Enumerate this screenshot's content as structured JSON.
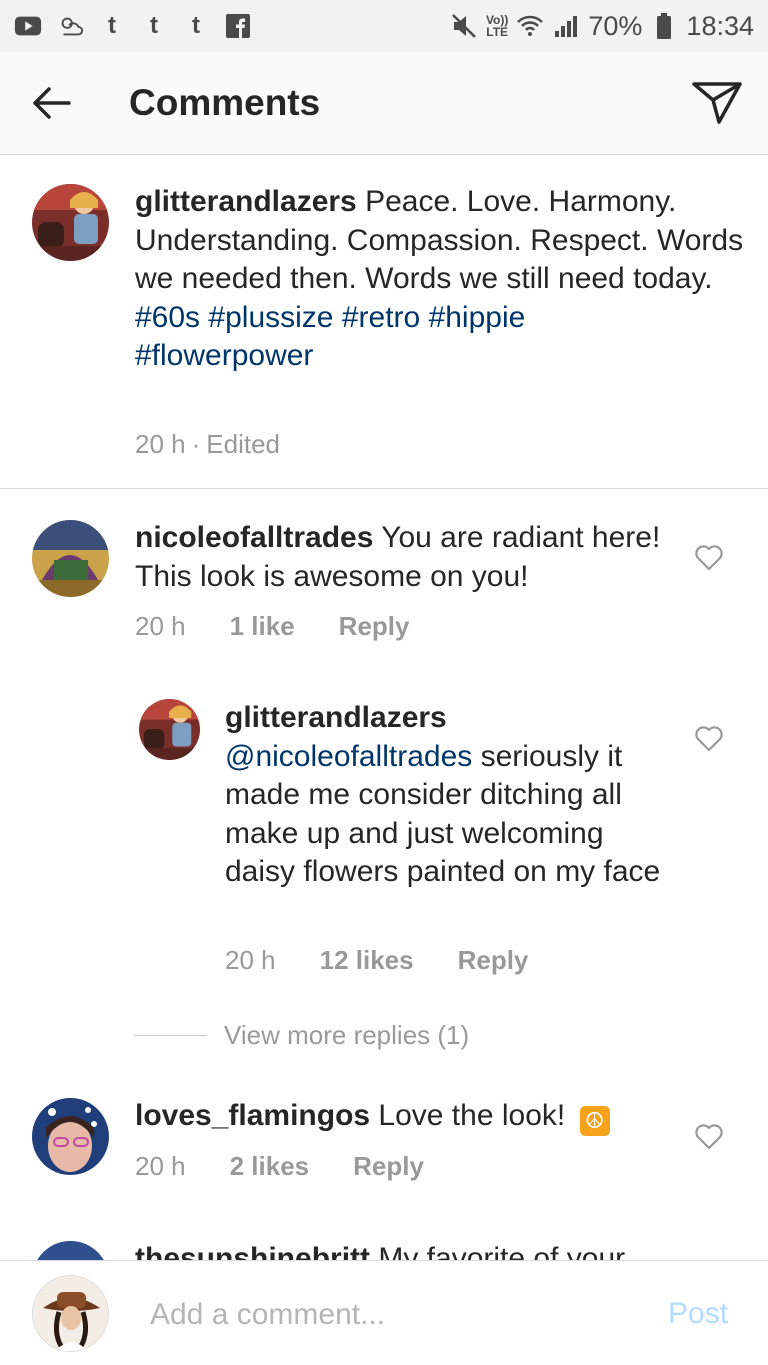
{
  "status_bar": {
    "left_icons": [
      "youtube-icon",
      "weather-icon",
      "tumblr-icon",
      "tumblr-icon",
      "tumblr-icon",
      "facebook-icon"
    ],
    "tumblr_glyph": "t",
    "facebook_glyph": "f",
    "lte_top": "Vo))",
    "lte_bottom": "LTE",
    "battery": "70%",
    "time": "18:34"
  },
  "header": {
    "title": "Comments"
  },
  "caption": {
    "username": "glitterandlazers",
    "text": "Peace. Love. Harmony. Understanding. Compassion. Respect. Words we needed then. Words we still need today.",
    "hashtags": [
      "#60s",
      "#plussize",
      "#retro",
      "#hippie",
      "#flowerpower"
    ],
    "time": "20 h",
    "separator": "·",
    "edited": "Edited"
  },
  "comments": [
    {
      "username": "nicoleofalltrades",
      "text": "You are radiant here! This look is awesome on you!",
      "time": "20 h",
      "likes": "1 like",
      "reply": "Reply"
    },
    {
      "username": "glitterandlazers",
      "mention": "@nicoleofalltrades",
      "text": "seriously it made me consider ditching all make up and just welcoming daisy flowers painted on my face",
      "time": "20 h",
      "likes": "12 likes",
      "reply": "Reply"
    },
    {
      "username": "loves_flamingos",
      "text": "Love the look!",
      "emoji": "☮",
      "time": "20 h",
      "likes": "2 likes",
      "reply": "Reply"
    },
    {
      "username": "thesunshinebritt",
      "text": "My favorite of your"
    }
  ],
  "view_more": "View more replies (1)",
  "composer": {
    "placeholder": "Add a comment...",
    "post": "Post"
  },
  "colors": {
    "hashtag": "#003569",
    "secondary_text": "#999999",
    "post_disabled": "#b3dbff",
    "peace_emoji_bg": "#f7a21b"
  }
}
